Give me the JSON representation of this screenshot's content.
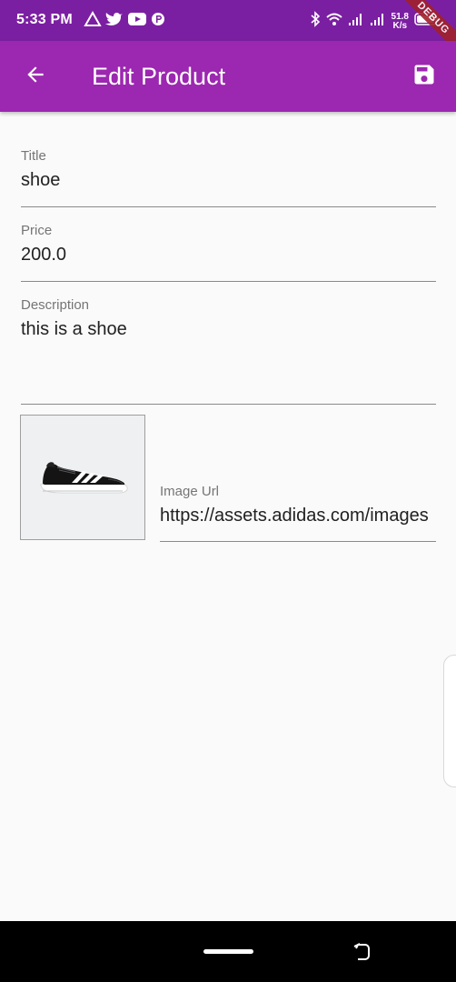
{
  "status_bar": {
    "time": "5:33 PM",
    "net_speed_value": "51.8",
    "net_speed_unit": "K/s",
    "debug_label": "DEBUG",
    "background": "#7b1fa2"
  },
  "app_bar": {
    "title": "Edit Product",
    "back_icon": "arrow-left-icon",
    "save_icon": "floppy-save-icon",
    "background": "#9c27b0"
  },
  "form": {
    "title": {
      "label": "Title",
      "value": "shoe"
    },
    "price": {
      "label": "Price",
      "value": "200.0"
    },
    "description": {
      "label": "Description",
      "value": "this is a shoe"
    },
    "image_url": {
      "label": "Image Url",
      "value": "https://assets.adidas.com/images"
    }
  }
}
